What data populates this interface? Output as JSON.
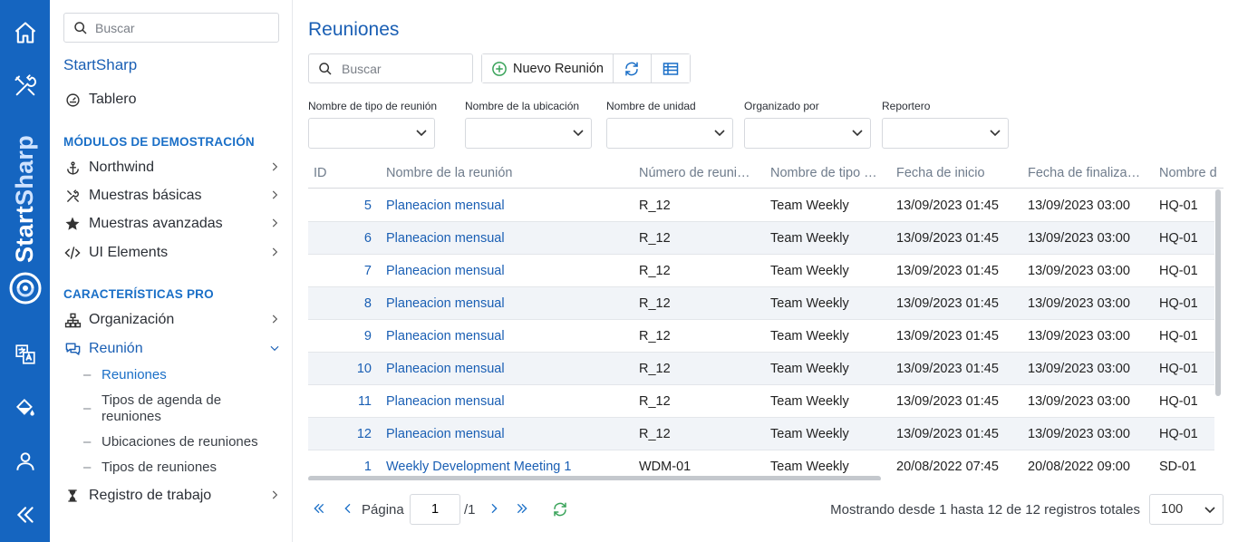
{
  "rail": {
    "brand_start": "Start",
    "brand_sharp": "Sharp",
    "icons": [
      "home-icon",
      "tools-icon",
      "translate-icon",
      "paint-bucket-icon",
      "user-icon",
      "collapse-icon"
    ]
  },
  "sidebar": {
    "search_placeholder": "Buscar",
    "app_title": "StartSharp",
    "dashboard": "Tablero",
    "section_demo": "MÓDULOS DE DEMOSTRACIÓN",
    "demo_items": [
      {
        "label": "Northwind",
        "icon": "anchor-icon"
      },
      {
        "label": "Muestras básicas",
        "icon": "wrench-icon"
      },
      {
        "label": "Muestras avanzadas",
        "icon": "star-icon"
      },
      {
        "label": "UI Elements",
        "icon": "code-icon"
      }
    ],
    "section_pro": "CARACTERÍSTICAS PRO",
    "pro_items": [
      {
        "label": "Organización",
        "icon": "org-chart-icon"
      },
      {
        "label": "Reunión",
        "icon": "chat-icon"
      }
    ],
    "meeting_sub": [
      {
        "label": "Reuniones"
      },
      {
        "label": "Tipos de agenda de reuniones"
      },
      {
        "label": "Ubicaciones de reuniones"
      },
      {
        "label": "Tipos de reuniones"
      }
    ],
    "worklog": "Registro de trabajo"
  },
  "main": {
    "title": "Reuniones",
    "search_placeholder": "Buscar",
    "new_button": "Nuevo Reunión",
    "filters": [
      {
        "label": "Nombre de tipo de reunión"
      },
      {
        "label": "Nombre de la ubicación"
      },
      {
        "label": "Nombre de unidad"
      },
      {
        "label": "Organizado por"
      },
      {
        "label": "Reportero"
      }
    ],
    "columns": [
      "ID",
      "Nombre de la reunión",
      "Número de reuni…",
      "Nombre de tipo …",
      "Fecha de inicio",
      "Fecha de finaliza…",
      "Nombre d"
    ],
    "rows": [
      {
        "id": "5",
        "name": "Planeacion mensual",
        "number": "R_12",
        "type": "Team Weekly",
        "start": "13/09/2023 01:45",
        "end": "13/09/2023 03:00",
        "location": "HQ-01"
      },
      {
        "id": "6",
        "name": "Planeacion mensual",
        "number": "R_12",
        "type": "Team Weekly",
        "start": "13/09/2023 01:45",
        "end": "13/09/2023 03:00",
        "location": "HQ-01"
      },
      {
        "id": "7",
        "name": "Planeacion mensual",
        "number": "R_12",
        "type": "Team Weekly",
        "start": "13/09/2023 01:45",
        "end": "13/09/2023 03:00",
        "location": "HQ-01"
      },
      {
        "id": "8",
        "name": "Planeacion mensual",
        "number": "R_12",
        "type": "Team Weekly",
        "start": "13/09/2023 01:45",
        "end": "13/09/2023 03:00",
        "location": "HQ-01"
      },
      {
        "id": "9",
        "name": "Planeacion mensual",
        "number": "R_12",
        "type": "Team Weekly",
        "start": "13/09/2023 01:45",
        "end": "13/09/2023 03:00",
        "location": "HQ-01"
      },
      {
        "id": "10",
        "name": "Planeacion mensual",
        "number": "R_12",
        "type": "Team Weekly",
        "start": "13/09/2023 01:45",
        "end": "13/09/2023 03:00",
        "location": "HQ-01"
      },
      {
        "id": "11",
        "name": "Planeacion mensual",
        "number": "R_12",
        "type": "Team Weekly",
        "start": "13/09/2023 01:45",
        "end": "13/09/2023 03:00",
        "location": "HQ-01"
      },
      {
        "id": "12",
        "name": "Planeacion mensual",
        "number": "R_12",
        "type": "Team Weekly",
        "start": "13/09/2023 01:45",
        "end": "13/09/2023 03:00",
        "location": "HQ-01"
      },
      {
        "id": "1",
        "name": "Weekly Development Meeting 1",
        "number": "WDM-01",
        "type": "Team Weekly",
        "start": "20/08/2022 07:45",
        "end": "20/08/2022 09:00",
        "location": "SD-01"
      }
    ],
    "pager": {
      "page_label": "Página",
      "page_value": "1",
      "total_pages": "/1",
      "status": "Mostrando desde 1 hasta 12 de 12 registros totales",
      "page_size": "100"
    }
  },
  "colors": {
    "rail": "#1565c0",
    "accent": "#1a5fb4",
    "section": "#1a6fc7",
    "refresh_green": "#3aa35a",
    "row_alt": "#f1f4f8"
  }
}
